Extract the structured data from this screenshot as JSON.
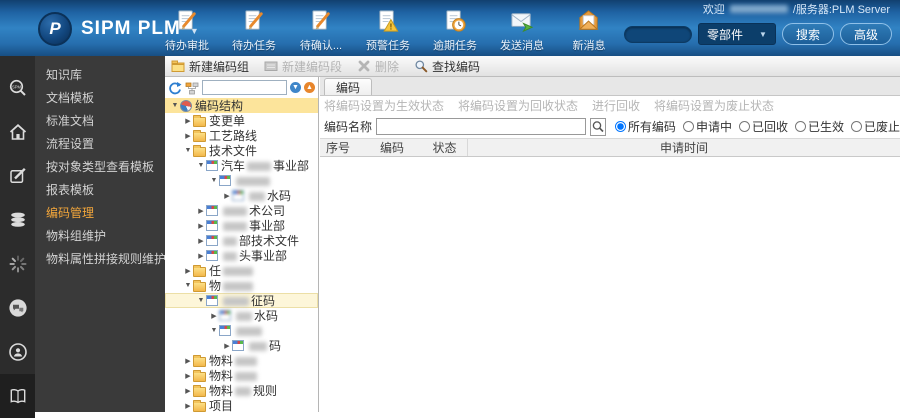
{
  "colors": {
    "topbar_blue": "#2a74b4",
    "active_menu_orange": "#f2a63b",
    "selection_yellow": "#fce49b"
  },
  "topbar": {
    "logo_text": "SIPM PLM",
    "welcome_prefix": "欢迎",
    "welcome_suffix": "/服务器:PLM Server",
    "toolbar_items": [
      {
        "icon": "doc-pencil",
        "label": "待办审批"
      },
      {
        "icon": "doc-pencil",
        "label": "待办任务"
      },
      {
        "icon": "doc-pencil",
        "label": "待确认..."
      },
      {
        "icon": "doc-warning",
        "label": "预警任务"
      },
      {
        "icon": "doc-clock",
        "label": "逾期任务"
      },
      {
        "icon": "mail-send",
        "label": "发送消息"
      },
      {
        "icon": "mail-new",
        "label": "新消息"
      }
    ],
    "search": {
      "input_value": "",
      "category": "零部件",
      "search_label": "搜索",
      "advanced_label": "高级"
    }
  },
  "sidebar": {
    "icons": [
      "spm-search",
      "home",
      "edit",
      "database",
      "loading",
      "chat",
      "broadcast",
      "book"
    ],
    "menu_items": [
      {
        "label": "知识库",
        "active": false
      },
      {
        "label": "文档模板",
        "active": false
      },
      {
        "label": "标准文档",
        "active": false
      },
      {
        "label": "流程设置",
        "active": false
      },
      {
        "label": "按对象类型查看模板",
        "active": false
      },
      {
        "label": "报表模板",
        "active": false
      },
      {
        "label": "编码管理",
        "active": true
      },
      {
        "label": "物料组维护",
        "active": false
      },
      {
        "label": "物料属性拼接规则维护",
        "active": false
      }
    ]
  },
  "content_toolbar": {
    "items": [
      {
        "icon": "folder-new",
        "label": "新建编码组",
        "disabled": false
      },
      {
        "icon": "segment-gray",
        "label": "新建编码段",
        "disabled": true
      },
      {
        "icon": "delete-x",
        "label": "删除",
        "disabled": true
      },
      {
        "icon": "magnifier",
        "label": "查找编码",
        "disabled": false
      }
    ]
  },
  "tree": {
    "items": [
      {
        "indent": 0,
        "exp": "open",
        "icon": "root",
        "prefix": "编码结构",
        "blur": 0,
        "suffix": "",
        "sel": "strong"
      },
      {
        "indent": 1,
        "exp": "closed",
        "icon": "folder",
        "prefix": "变更单",
        "blur": 0,
        "suffix": "",
        "sel": ""
      },
      {
        "indent": 1,
        "exp": "closed",
        "icon": "folder",
        "prefix": "工艺路线",
        "blur": 0,
        "suffix": "",
        "sel": ""
      },
      {
        "indent": 1,
        "exp": "open",
        "icon": "folder",
        "prefix": "技术文件",
        "blur": 0,
        "suffix": "",
        "sel": ""
      },
      {
        "indent": 2,
        "exp": "open",
        "icon": "segment",
        "prefix": "汽车",
        "blur": 24,
        "suffix": "事业部",
        "sel": ""
      },
      {
        "indent": 3,
        "exp": "open",
        "icon": "segment",
        "prefix": "",
        "blur": 34,
        "suffix": "",
        "sel": ""
      },
      {
        "indent": 4,
        "exp": "closed",
        "icon": "segment-blur",
        "prefix": "",
        "blur": 16,
        "suffix": "水码",
        "sel": ""
      },
      {
        "indent": 2,
        "exp": "closed",
        "icon": "segment",
        "prefix": "",
        "blur": 24,
        "suffix": "术公司",
        "sel": ""
      },
      {
        "indent": 2,
        "exp": "closed",
        "icon": "segment",
        "prefix": "",
        "blur": 24,
        "suffix": "事业部",
        "sel": ""
      },
      {
        "indent": 2,
        "exp": "closed",
        "icon": "segment",
        "prefix": "",
        "blur": 14,
        "suffix": "部技术文件",
        "sel": ""
      },
      {
        "indent": 2,
        "exp": "closed",
        "icon": "segment",
        "prefix": "",
        "blur": 14,
        "suffix": "头事业部",
        "sel": ""
      },
      {
        "indent": 1,
        "exp": "closed",
        "icon": "folder",
        "prefix": "任",
        "blur": 30,
        "suffix": "",
        "sel": ""
      },
      {
        "indent": 1,
        "exp": "open",
        "icon": "folder",
        "prefix": "物",
        "blur": 30,
        "suffix": "",
        "sel": ""
      },
      {
        "indent": 2,
        "exp": "open",
        "icon": "segment",
        "prefix": "",
        "blur": 26,
        "suffix": "征码",
        "sel": "light"
      },
      {
        "indent": 3,
        "exp": "closed",
        "icon": "segment-blur",
        "prefix": "",
        "blur": 16,
        "suffix": "水码",
        "sel": ""
      },
      {
        "indent": 3,
        "exp": "open",
        "icon": "segment",
        "prefix": "",
        "blur": 26,
        "suffix": "",
        "sel": ""
      },
      {
        "indent": 4,
        "exp": "closed",
        "icon": "segment",
        "prefix": "",
        "blur": 18,
        "suffix": "码",
        "sel": ""
      },
      {
        "indent": 1,
        "exp": "closed",
        "icon": "folder",
        "prefix": "物料",
        "blur": 22,
        "suffix": "",
        "sel": ""
      },
      {
        "indent": 1,
        "exp": "closed",
        "icon": "folder",
        "prefix": "物料",
        "blur": 22,
        "suffix": "",
        "sel": ""
      },
      {
        "indent": 1,
        "exp": "closed",
        "icon": "folder",
        "prefix": "物料",
        "blur": 16,
        "suffix": "规则",
        "sel": ""
      },
      {
        "indent": 1,
        "exp": "closed",
        "icon": "folder",
        "prefix": "项目",
        "blur": 0,
        "suffix": "",
        "sel": ""
      }
    ]
  },
  "main": {
    "tab_label": "编码",
    "action_links": [
      "将编码设置为生效状态",
      "将编码设置为回收状态",
      "进行回收",
      "将编码设置为废止状态"
    ],
    "filter": {
      "label": "编码名称",
      "input_value": "",
      "radios": [
        {
          "label": "所有编码",
          "checked": true
        },
        {
          "label": "申请中",
          "checked": false
        },
        {
          "label": "已回收",
          "checked": false
        },
        {
          "label": "已生效",
          "checked": false
        },
        {
          "label": "已废止",
          "checked": false
        }
      ]
    },
    "table": {
      "columns": [
        "序号",
        "编码",
        "状态",
        "申请时间"
      ],
      "rows": []
    }
  }
}
